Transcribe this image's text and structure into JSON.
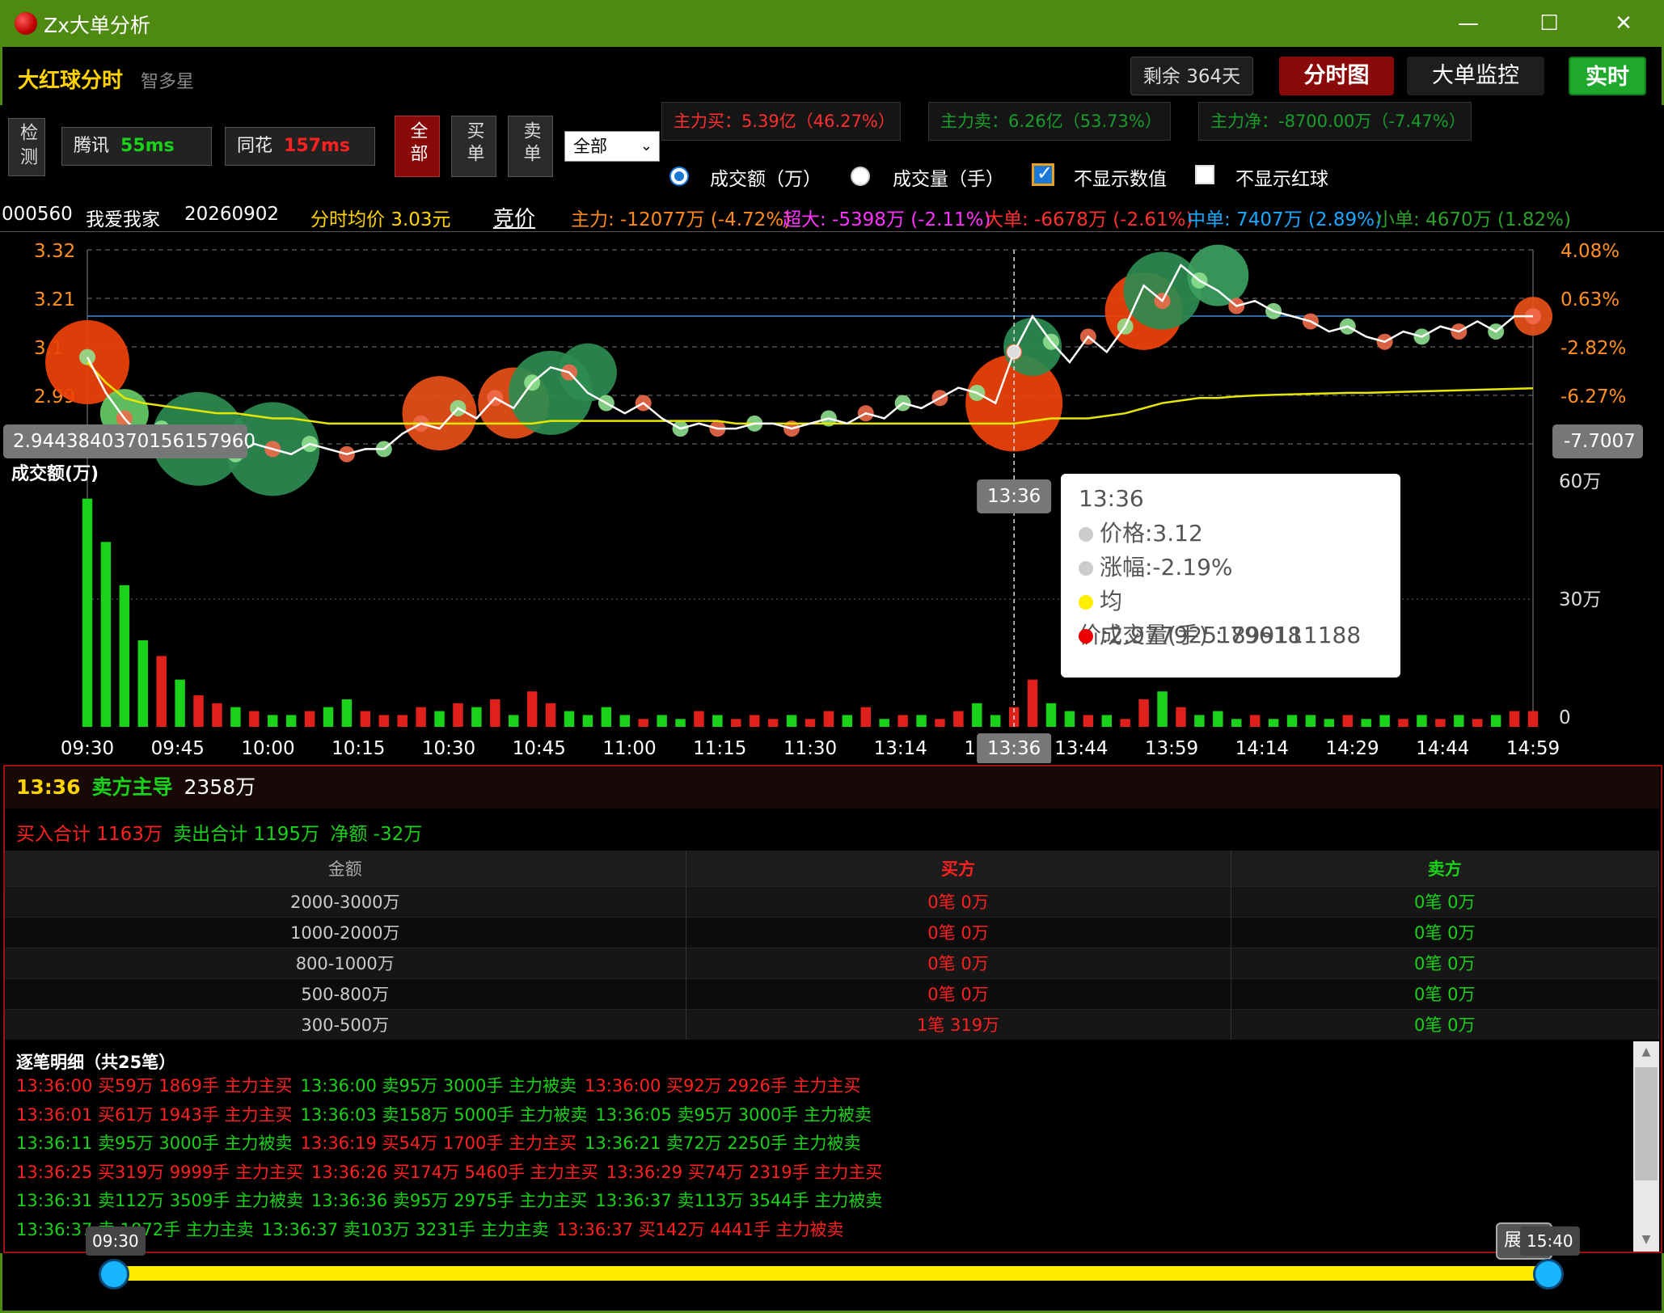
{
  "window": {
    "title": "Zx大单分析"
  },
  "header": {
    "title": "大红球分时",
    "brand": "智多星",
    "remaining": "剩余 364天",
    "tab_fenshi": "分时图",
    "tab_dadan": "大单监控",
    "realtime": "实时"
  },
  "toolbar": {
    "detect": "检测",
    "tencent_label": "腾讯",
    "tencent_ms": "55ms",
    "tonghua_label": "同花",
    "tonghua_ms": "157ms",
    "filter_all": "全部",
    "filter_buy": "买单",
    "filter_sell": "卖单",
    "range_value": "全部",
    "main_buy": "主力买：5.39亿（46.27%）",
    "main_sell": "主力卖：6.26亿（53.73%）",
    "main_net": "主力净：-8700.00万（-7.47%）",
    "opt_amount": "成交额（万）",
    "opt_volume": "成交量（手）",
    "opt_hide_values": "不显示数值",
    "opt_hide_balls": "不显示红球"
  },
  "info": {
    "code": "000560",
    "name": "我爱我家",
    "date": "20260902",
    "avg_price": "分时均价 3.03元",
    "bidding": "竞价",
    "main": "主力: -12077万 (-4.72%)",
    "super": "超大: -5398万 (-2.11%)",
    "large": "大单: -6678万 (-2.61%)",
    "medium": "中单: 7407万 (2.89%)",
    "small": "小单: 4670万 (1.82%)"
  },
  "chart_data": {
    "type": "line",
    "price_ticks": [
      "3.32",
      "3.21",
      "3.1",
      "2.99"
    ],
    "pct_ticks": [
      "4.08%",
      "0.63%",
      "-2.82%",
      "-6.27%",
      "-9.72%"
    ],
    "volume_ticks": [
      "60万",
      "30万",
      "0"
    ],
    "volume_label": "成交额(万)",
    "x_ticks": [
      "09:30",
      "09:45",
      "10:00",
      "10:15",
      "10:30",
      "10:45",
      "11:00",
      "11:15",
      "11:30",
      "13:14",
      "13:29",
      "13:44",
      "13:59",
      "14:14",
      "14:29",
      "14:44",
      "14:59"
    ],
    "price_cursor_label": "2.9443840370156157960",
    "pct_cursor_label": "-7.7007",
    "time_cursor_label": "13:36",
    "ylim": [
      2.88,
      3.32
    ],
    "price": [
      3.11,
      3.04,
      2.99,
      2.95,
      2.97,
      2.93,
      2.94,
      2.95,
      2.92,
      2.94,
      2.93,
      2.92,
      2.94,
      2.93,
      2.92,
      2.93,
      2.93,
      2.96,
      2.98,
      2.97,
      3.01,
      2.99,
      3.03,
      3.01,
      3.06,
      3.09,
      3.08,
      3.04,
      3.02,
      3.0,
      3.02,
      2.99,
      2.97,
      2.98,
      2.97,
      2.97,
      2.98,
      2.98,
      2.97,
      2.98,
      2.99,
      2.98,
      3.0,
      2.99,
      3.02,
      3.01,
      3.03,
      3.05,
      3.04,
      3.02,
      3.12,
      3.19,
      3.14,
      3.1,
      3.15,
      3.12,
      3.17,
      3.25,
      3.22,
      3.29,
      3.26,
      3.24,
      3.21,
      3.22,
      3.2,
      3.19,
      3.18,
      3.16,
      3.17,
      3.15,
      3.14,
      3.16,
      3.15,
      3.17,
      3.16,
      3.18,
      3.16,
      3.19,
      3.19
    ],
    "avg": [
      3.1,
      3.06,
      3.03,
      3.02,
      3.015,
      3.01,
      3.005,
      3.0,
      3.0,
      2.995,
      2.99,
      2.99,
      2.985,
      2.98,
      2.98,
      2.98,
      2.98,
      2.98,
      2.98,
      2.98,
      2.98,
      2.98,
      2.98,
      2.98,
      2.98,
      2.985,
      2.985,
      2.985,
      2.985,
      2.985,
      2.985,
      2.985,
      2.985,
      2.985,
      2.985,
      2.98,
      2.98,
      2.98,
      2.98,
      2.98,
      2.98,
      2.98,
      2.98,
      2.98,
      2.98,
      2.98,
      2.98,
      2.98,
      2.98,
      2.98,
      2.98,
      2.985,
      2.99,
      2.99,
      2.99,
      2.995,
      3.0,
      3.01,
      3.02,
      3.025,
      3.03,
      3.03,
      3.033,
      3.035,
      3.036,
      3.037,
      3.038,
      3.039,
      3.04,
      3.04,
      3.041,
      3.042,
      3.043,
      3.044,
      3.045,
      3.046,
      3.047,
      3.048,
      3.049
    ],
    "volume": [
      58,
      47,
      36,
      22,
      18,
      12,
      8,
      6,
      5,
      4,
      3,
      3,
      4,
      5,
      7,
      4,
      3,
      3,
      5,
      4,
      6,
      5,
      7,
      3,
      9,
      6,
      4,
      3,
      5,
      3,
      2,
      3,
      2,
      4,
      3,
      2,
      3,
      2,
      3,
      2,
      4,
      3,
      5,
      2,
      3,
      3,
      2,
      4,
      6,
      3,
      5,
      12,
      6,
      4,
      3,
      3,
      2,
      7,
      9,
      5,
      3,
      4,
      2,
      3,
      2,
      3,
      3,
      2,
      3,
      2,
      3,
      2,
      3,
      2,
      3,
      2,
      3,
      4,
      4
    ],
    "volume_max": 60,
    "balls": [
      {
        "i": 0,
        "v": 3.1,
        "r": 52,
        "c": "#f0420a"
      },
      {
        "i": 2,
        "v": 3.0,
        "r": 30,
        "c": "#66cc66"
      },
      {
        "i": 6,
        "v": 2.95,
        "r": 58,
        "c": "#2e8b50"
      },
      {
        "i": 10,
        "v": 2.93,
        "r": 58,
        "c": "#2e8b50"
      },
      {
        "i": 19,
        "v": 3.0,
        "r": 46,
        "c": "#e8501a"
      },
      {
        "i": 23,
        "v": 3.02,
        "r": 44,
        "c": "#e8501a"
      },
      {
        "i": 25,
        "v": 3.04,
        "r": 52,
        "c": "#2e8b50"
      },
      {
        "i": 27,
        "v": 3.08,
        "r": 36,
        "c": "#2e8b50"
      },
      {
        "i": 50,
        "v": 3.02,
        "r": 60,
        "c": "#f0420a"
      },
      {
        "i": 51,
        "v": 3.13,
        "r": 36,
        "c": "#2e8b50"
      },
      {
        "i": 57,
        "v": 3.2,
        "r": 48,
        "c": "#f0420a"
      },
      {
        "i": 58,
        "v": 3.24,
        "r": 48,
        "c": "#2e8b50"
      },
      {
        "i": 61,
        "v": 3.27,
        "r": 38,
        "c": "#3da060"
      },
      {
        "i": 78,
        "v": 3.19,
        "r": 24,
        "c": "#e8501a"
      }
    ]
  },
  "tooltip": {
    "time": "13:36",
    "price": "价格:3.12",
    "change": "涨幅:-2.19%",
    "avg": "均价:2.9779251899111188",
    "volume": "成交量(手) : 79618"
  },
  "summary": {
    "time": "13:36",
    "direction": "卖方主导",
    "amount": "2358万",
    "buy_total": "买入合计 1163万",
    "sell_total": "卖出合计 1195万",
    "net": "净额 -32万"
  },
  "amount_table": {
    "headers": [
      "金额",
      "买方",
      "卖方"
    ],
    "rows": [
      [
        "2000-3000万",
        "0笔 0万",
        "0笔 0万"
      ],
      [
        "1000-2000万",
        "0笔 0万",
        "0笔 0万"
      ],
      [
        "800-1000万",
        "0笔 0万",
        "0笔 0万"
      ],
      [
        "500-800万",
        "0笔 0万",
        "0笔 0万"
      ],
      [
        "300-500万",
        "1笔 319万",
        "0笔 0万"
      ]
    ]
  },
  "details": {
    "title": "逐笔明细（共25笔）",
    "lines": [
      [
        [
          "13:36:00 买59万 1869手 主力主买",
          "buy"
        ],
        [
          "13:36:00 卖95万 3000手 主力被卖",
          "sell"
        ],
        [
          "13:36:00 买92万 2926手 主力主买",
          "buy"
        ]
      ],
      [
        [
          "13:36:01 买61万 1943手 主力主买",
          "buy"
        ],
        [
          "13:36:03 卖158万 5000手 主力被卖",
          "sell"
        ],
        [
          "13:36:05 卖95万 3000手 主力被卖",
          "sell"
        ]
      ],
      [
        [
          "13:36:11 卖95万 3000手 主力被卖",
          "sell"
        ],
        [
          "13:36:19 买54万 1700手 主力主买",
          "buy"
        ],
        [
          "13:36:21 卖72万 2250手 主力被卖",
          "sell"
        ]
      ],
      [
        [
          "13:36:25 买319万 9999手 主力主买",
          "buy"
        ],
        [
          "13:36:26 买174万 5460手 主力主买",
          "buy"
        ],
        [
          "13:36:29 买74万 2319手 主力主买",
          "buy"
        ]
      ],
      [
        [
          "13:36:31 卖112万 3509手 主力被卖",
          "sell"
        ],
        [
          "13:36:36 卖95万 2975手 主力主买",
          "sell"
        ],
        [
          "13:36:37 卖113万 3544手 主力被卖",
          "sell"
        ]
      ],
      [
        [
          "13:36:37 卖 1872手 主力主卖",
          "sell"
        ],
        [
          "13:36:37 卖103万 3231手 主力主卖",
          "sell"
        ],
        [
          "13:36:37 买142万 4441手 主力被卖",
          "buy"
        ]
      ]
    ]
  },
  "slider": {
    "start": "09:30",
    "end": "15:40",
    "hidden_label": "展"
  },
  "colors": {
    "up": "#ff2020",
    "down": "#19d219",
    "accent_yellow": "#ffd400",
    "avg_line": "#e6e600"
  }
}
